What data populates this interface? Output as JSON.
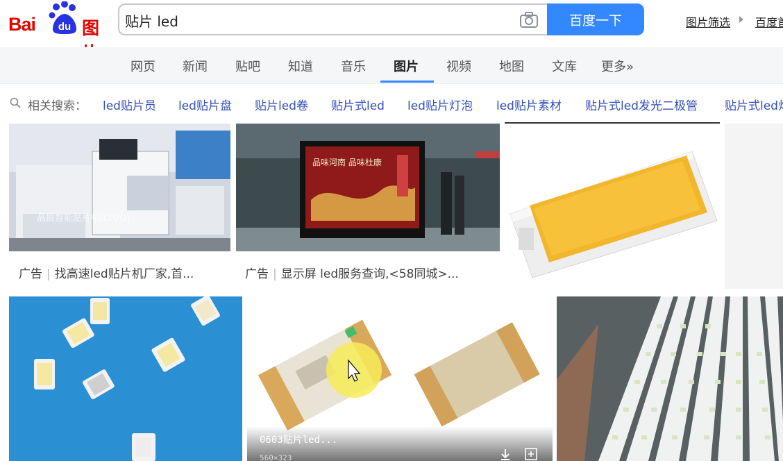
{
  "logo": {
    "bai": "Bai",
    "du": "du",
    "tu": "图片"
  },
  "search": {
    "value": "贴片 led",
    "button": "百度一下"
  },
  "header_links": {
    "filter": "图片筛选",
    "baidu": "百度首页"
  },
  "nav": {
    "items": [
      "网页",
      "新闻",
      "贴吧",
      "知道",
      "音乐",
      "图片",
      "视频",
      "地图",
      "文库",
      "更多»"
    ],
    "active": "图片"
  },
  "related": {
    "label": "相关搜索：",
    "items": [
      "led贴片员",
      "led贴片盘",
      "贴片led卷",
      "贴片式led",
      "led贴片灯泡",
      "led贴片素材",
      "贴片式led发光二极管",
      "贴片式led灯"
    ]
  },
  "results": {
    "ad1": {
      "tag": "广告",
      "text": "找高速led贴片机厂家,首..."
    },
    "ad2": {
      "tag": "广告",
      "text": "显示屏 led服务查询,<58同城>..."
    },
    "ad1_watermark": "晶振智能贴片机(LTUO)",
    "ad2_banner": "品味河南 品味杜康",
    "hover_title": "0603贴片led...",
    "hover_size": "560×323"
  },
  "colors": {
    "brand_red": "#e10602",
    "brand_blue": "#3388ff",
    "link": "#3451bd"
  }
}
